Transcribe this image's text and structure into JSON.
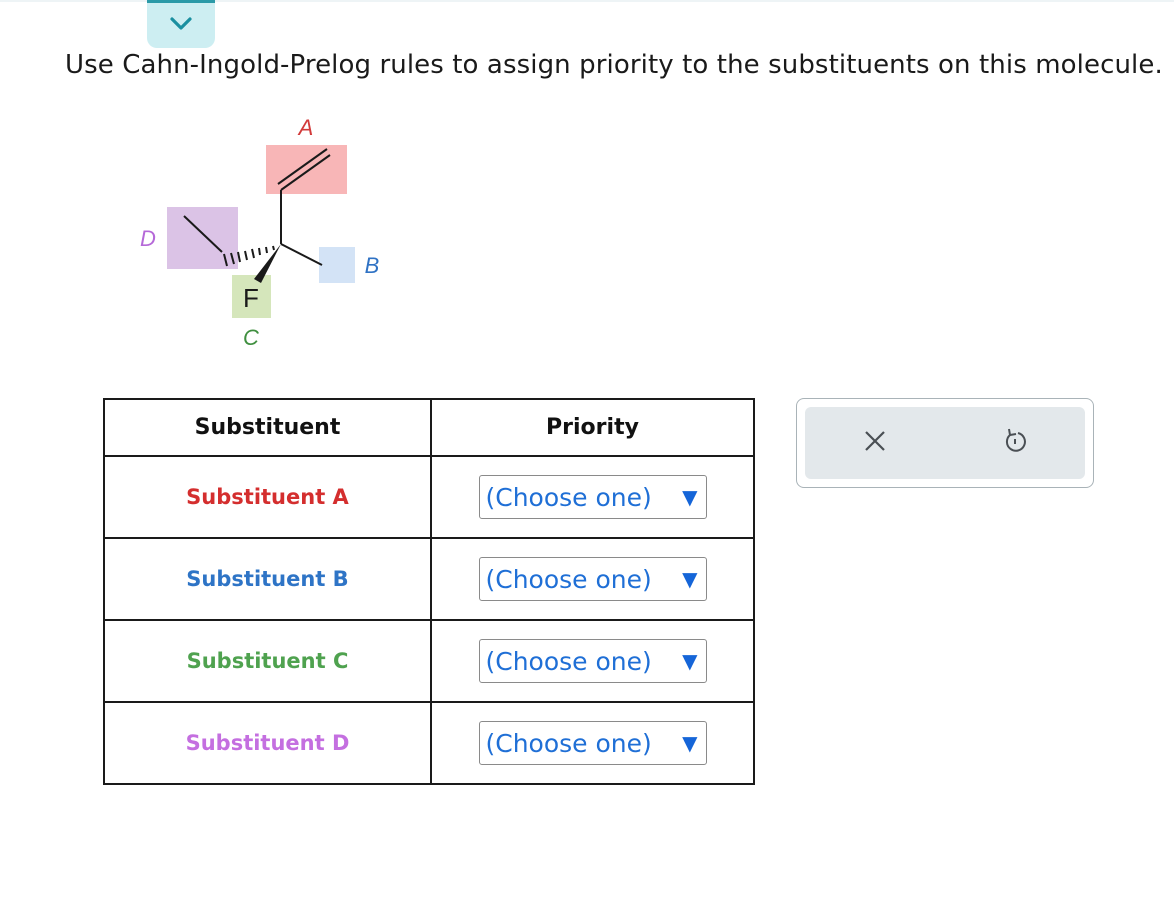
{
  "question": {
    "text": "Use Cahn-Ingold-Prelog rules to assign priority to the substituents on this molecule."
  },
  "molecule": {
    "labels": {
      "a": "A",
      "b": "B",
      "c": "C",
      "d": "D"
    },
    "atom_f": "F",
    "colors": {
      "a_box": "#f8b6b7",
      "a_text": "#d23a3a",
      "b_box": "#d3e3f6",
      "b_text": "#2f72c4",
      "c_box": "#d5e6bb",
      "c_text": "#3f8f3f",
      "d_box": "#dbc3e6",
      "d_text": "#b569d8"
    }
  },
  "table": {
    "headers": {
      "substituent": "Substituent",
      "priority": "Priority"
    },
    "rows": [
      {
        "label": "Substituent A",
        "color": "#d42e2e",
        "value": "(Choose one)"
      },
      {
        "label": "Substituent B",
        "color": "#2e74c6",
        "value": "(Choose one)"
      },
      {
        "label": "Substituent C",
        "color": "#4fa24f",
        "value": "(Choose one)"
      },
      {
        "label": "Substituent D",
        "color": "#c46fe0",
        "value": "(Choose one)"
      }
    ]
  },
  "tools": {
    "clear_icon": "close-icon",
    "undo_icon": "undo-icon"
  }
}
